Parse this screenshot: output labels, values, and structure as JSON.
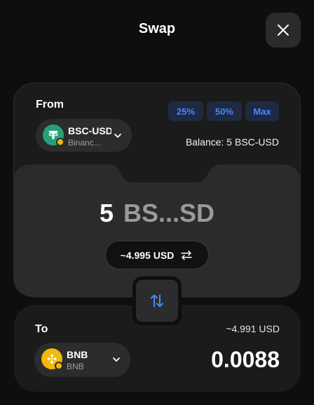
{
  "header": {
    "title": "Swap",
    "close_icon": "close-icon"
  },
  "from": {
    "label": "From",
    "token": {
      "symbol": "BSC-USD",
      "chain": "Binanc...",
      "icon": "tether-icon",
      "color": "#26a17b"
    },
    "percent_buttons": [
      "25%",
      "50%",
      "Max"
    ],
    "balance": "Balance: 5 BSC-USD",
    "amount": "5",
    "amount_unit": "BS...SD",
    "usd_value": "~4.995 USD"
  },
  "swap_icon": "swap-direction-icon",
  "to": {
    "label": "To",
    "usd_value": "~4.991 USD",
    "token": {
      "symbol": "BNB",
      "chain": "BNB",
      "icon": "bnb-icon",
      "color": "#f0b90b"
    },
    "amount": "0.0088"
  },
  "colors": {
    "accent": "#4a86ff",
    "background": "#0e0e0e",
    "card": "#1b1b1b"
  }
}
